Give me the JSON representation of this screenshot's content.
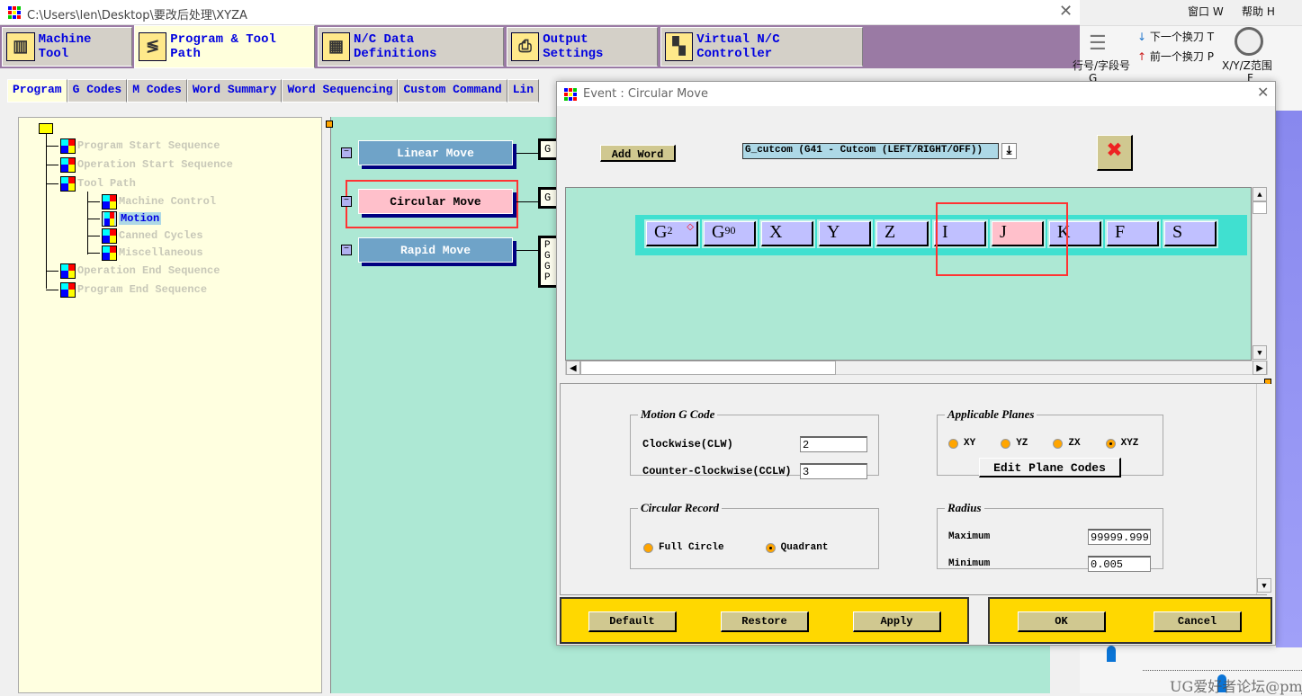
{
  "window": {
    "title": "C:\\Users\\len\\Desktop\\要改后处理\\XYZA"
  },
  "main_tabs": [
    {
      "label": "Machine Tool"
    },
    {
      "label": "Program & Tool Path"
    },
    {
      "label": "N/C Data Definitions"
    },
    {
      "label": "Output Settings"
    },
    {
      "label": "Virtual N/C Controller"
    }
  ],
  "sub_tabs": [
    {
      "label": "Program"
    },
    {
      "label": "G Codes"
    },
    {
      "label": "M Codes"
    },
    {
      "label": "Word Summary"
    },
    {
      "label": "Word Sequencing"
    },
    {
      "label": "Custom Command"
    },
    {
      "label": "Lin"
    }
  ],
  "tree": {
    "items": [
      {
        "label": "Program Start Sequence"
      },
      {
        "label": "Operation Start Sequence"
      },
      {
        "label": "Tool Path"
      },
      {
        "label": "Machine Control"
      },
      {
        "label": "Motion"
      },
      {
        "label": "Canned Cycles"
      },
      {
        "label": "Miscellaneous"
      },
      {
        "label": "Operation End Sequence"
      },
      {
        "label": "Program End Sequence"
      }
    ]
  },
  "events": [
    {
      "label": "Linear Move",
      "box": "G"
    },
    {
      "label": "Circular Move",
      "box": "G"
    },
    {
      "label": "Rapid Move",
      "box": "P\nG\nG\nP"
    }
  ],
  "right_app": {
    "menu": [
      "窗口 W",
      "帮助 H"
    ],
    "items": [
      "行号/字段号",
      "下一个换刀 T",
      "前一个换刀 P",
      "X/Y/Z范围"
    ],
    "sub": [
      "G",
      "F"
    ],
    "watermark": "UG爱好者论坛@pmjxc"
  },
  "dialog": {
    "title": "Event : Circular Move",
    "add_word": "Add Word",
    "word_select": "G_cutcom (G41 - Cutcom (LEFT/RIGHT/OFF))",
    "words": [
      {
        "letter": "G",
        "sub": "2"
      },
      {
        "letter": "G",
        "sub": "90"
      },
      {
        "letter": "X",
        "sub": ""
      },
      {
        "letter": "Y",
        "sub": ""
      },
      {
        "letter": "Z",
        "sub": ""
      },
      {
        "letter": "I",
        "sub": ""
      },
      {
        "letter": "J",
        "sub": ""
      },
      {
        "letter": "K",
        "sub": ""
      },
      {
        "letter": "F",
        "sub": ""
      },
      {
        "letter": "S",
        "sub": ""
      }
    ],
    "selected_word": "J",
    "motion": {
      "legend": "Motion G Code",
      "cw_label": "Clockwise(CLW)",
      "cw_value": "2",
      "ccw_label": "Counter-Clockwise(CCLW)",
      "ccw_value": "3"
    },
    "planes": {
      "legend": "Applicable Planes",
      "options": [
        "XY",
        "YZ",
        "ZX",
        "XYZ"
      ],
      "selected": "XYZ",
      "edit_button": "Edit Plane Codes"
    },
    "record": {
      "legend": "Circular Record",
      "options": [
        "Full Circle",
        "Quadrant"
      ],
      "selected": "Quadrant"
    },
    "radius": {
      "legend": "Radius",
      "max_label": "Maximum",
      "max_value": "99999.999",
      "min_label": "Minimum",
      "min_value": "0.005"
    },
    "buttons": {
      "default": "Default",
      "restore": "Restore",
      "apply": "Apply",
      "ok": "OK",
      "cancel": "Cancel"
    }
  },
  "colors": {
    "accent_blue": "#0000e0",
    "panel_green": "#ade8d4",
    "word_bar": "#40e0d0",
    "button_bar": "#ffd800",
    "selected": "#ffc0cb",
    "highlight": "#ff3333"
  }
}
